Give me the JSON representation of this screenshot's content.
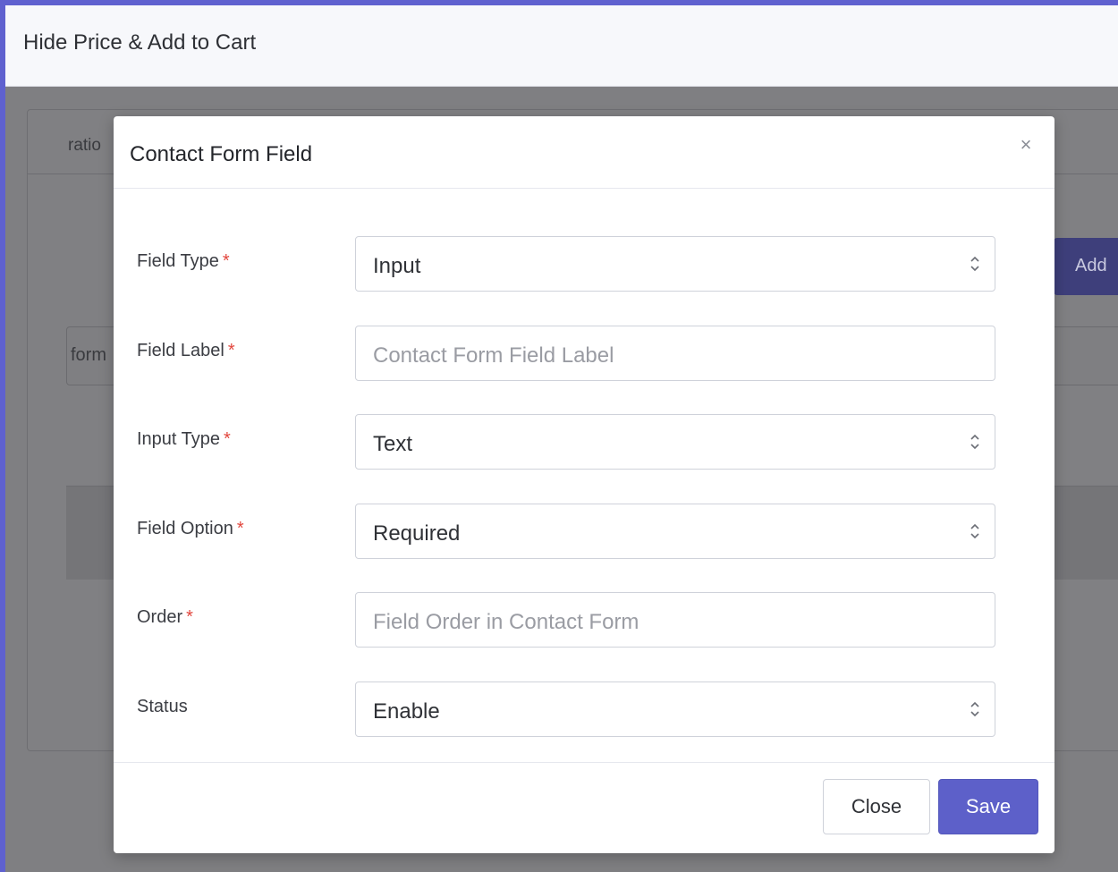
{
  "app": {
    "title": "Hide Price & Add to Cart"
  },
  "background": {
    "tab_fragment": "ratio",
    "add_fragment": "Add",
    "input_fragment": "form"
  },
  "modal": {
    "title": "Contact Form Field",
    "close_symbol": "×",
    "fields": [
      {
        "label": "Field Type",
        "required_mark": "*",
        "value": "Input",
        "placeholder": ""
      },
      {
        "label": "Field Label",
        "required_mark": "*",
        "value": "",
        "placeholder": "Contact Form Field Label"
      },
      {
        "label": "Input Type",
        "required_mark": "*",
        "value": "Text",
        "placeholder": ""
      },
      {
        "label": "Field Option",
        "required_mark": "*",
        "value": "Required",
        "placeholder": ""
      },
      {
        "label": "Order",
        "required_mark": "*",
        "value": "",
        "placeholder": "Field Order in Contact Form"
      },
      {
        "label": "Status",
        "required_mark": "",
        "value": "Enable",
        "placeholder": ""
      }
    ],
    "buttons": {
      "close": "Close",
      "save": "Save"
    }
  },
  "colors": {
    "accent": "#5d60c9",
    "required": "#e2463d",
    "frame": "#5f61cf"
  },
  "icons": {
    "select_arrows": "updown-chevron-icon",
    "close": "close-icon"
  }
}
